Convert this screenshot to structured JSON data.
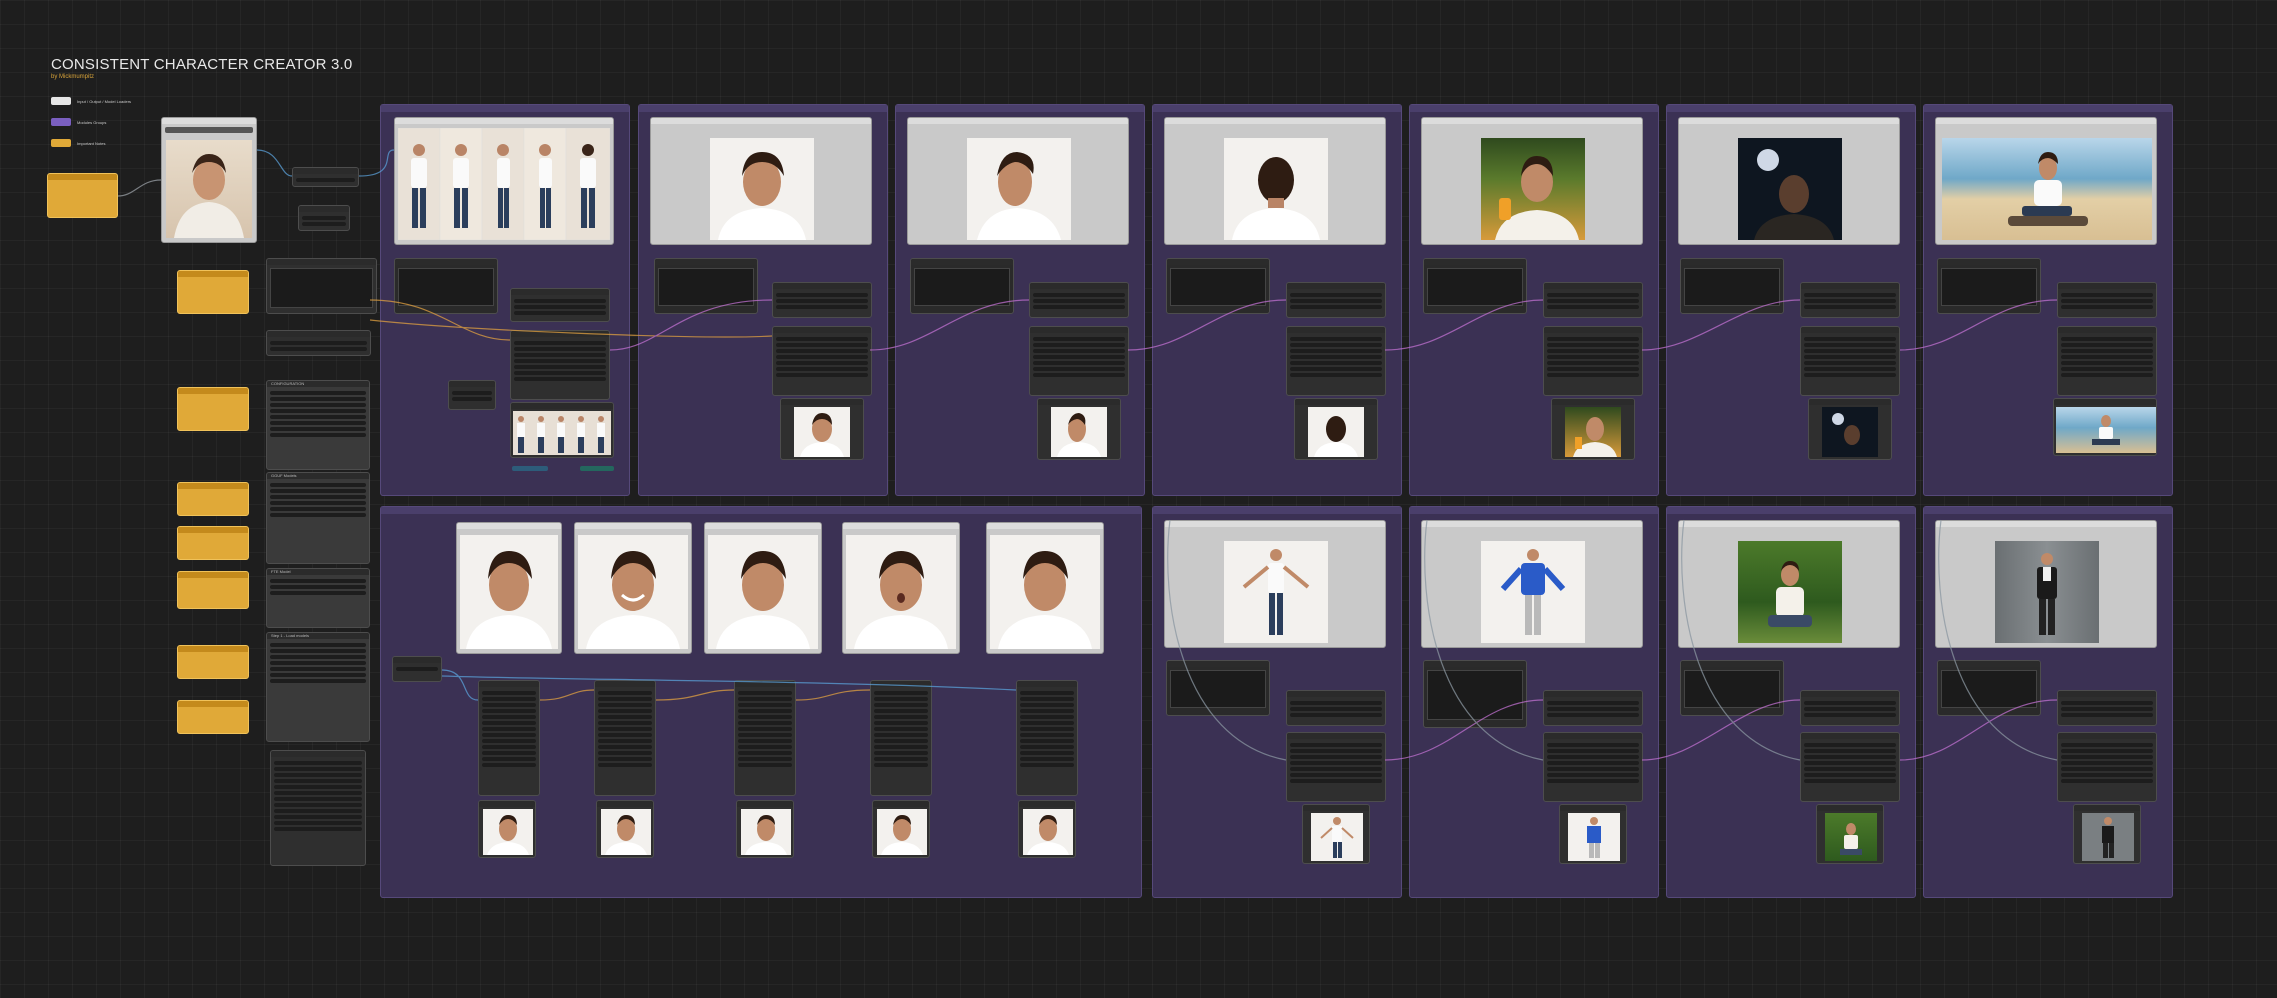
{
  "header": {
    "title": "CONSISTENT CHARACTER CREATOR 3.0",
    "subtitle": "by Mickmumpitz"
  },
  "legend": [
    {
      "label": "Input / Output / Model Loaders",
      "color": "#e6e6e6"
    },
    {
      "label": "Modules Groups",
      "color": "#7a5fc0"
    },
    {
      "label": "Important Notes",
      "color": "#e0a938"
    }
  ],
  "sidebar": {
    "configuration_label": "CONFIGURATION",
    "gguf_label": "GGUF Models",
    "flux_label": "FTE Model",
    "load_models_label": "Step 1 - Load models"
  },
  "colors": {
    "background": "#1e1e1e",
    "group": "#3b3154",
    "note": "#e0a938"
  }
}
